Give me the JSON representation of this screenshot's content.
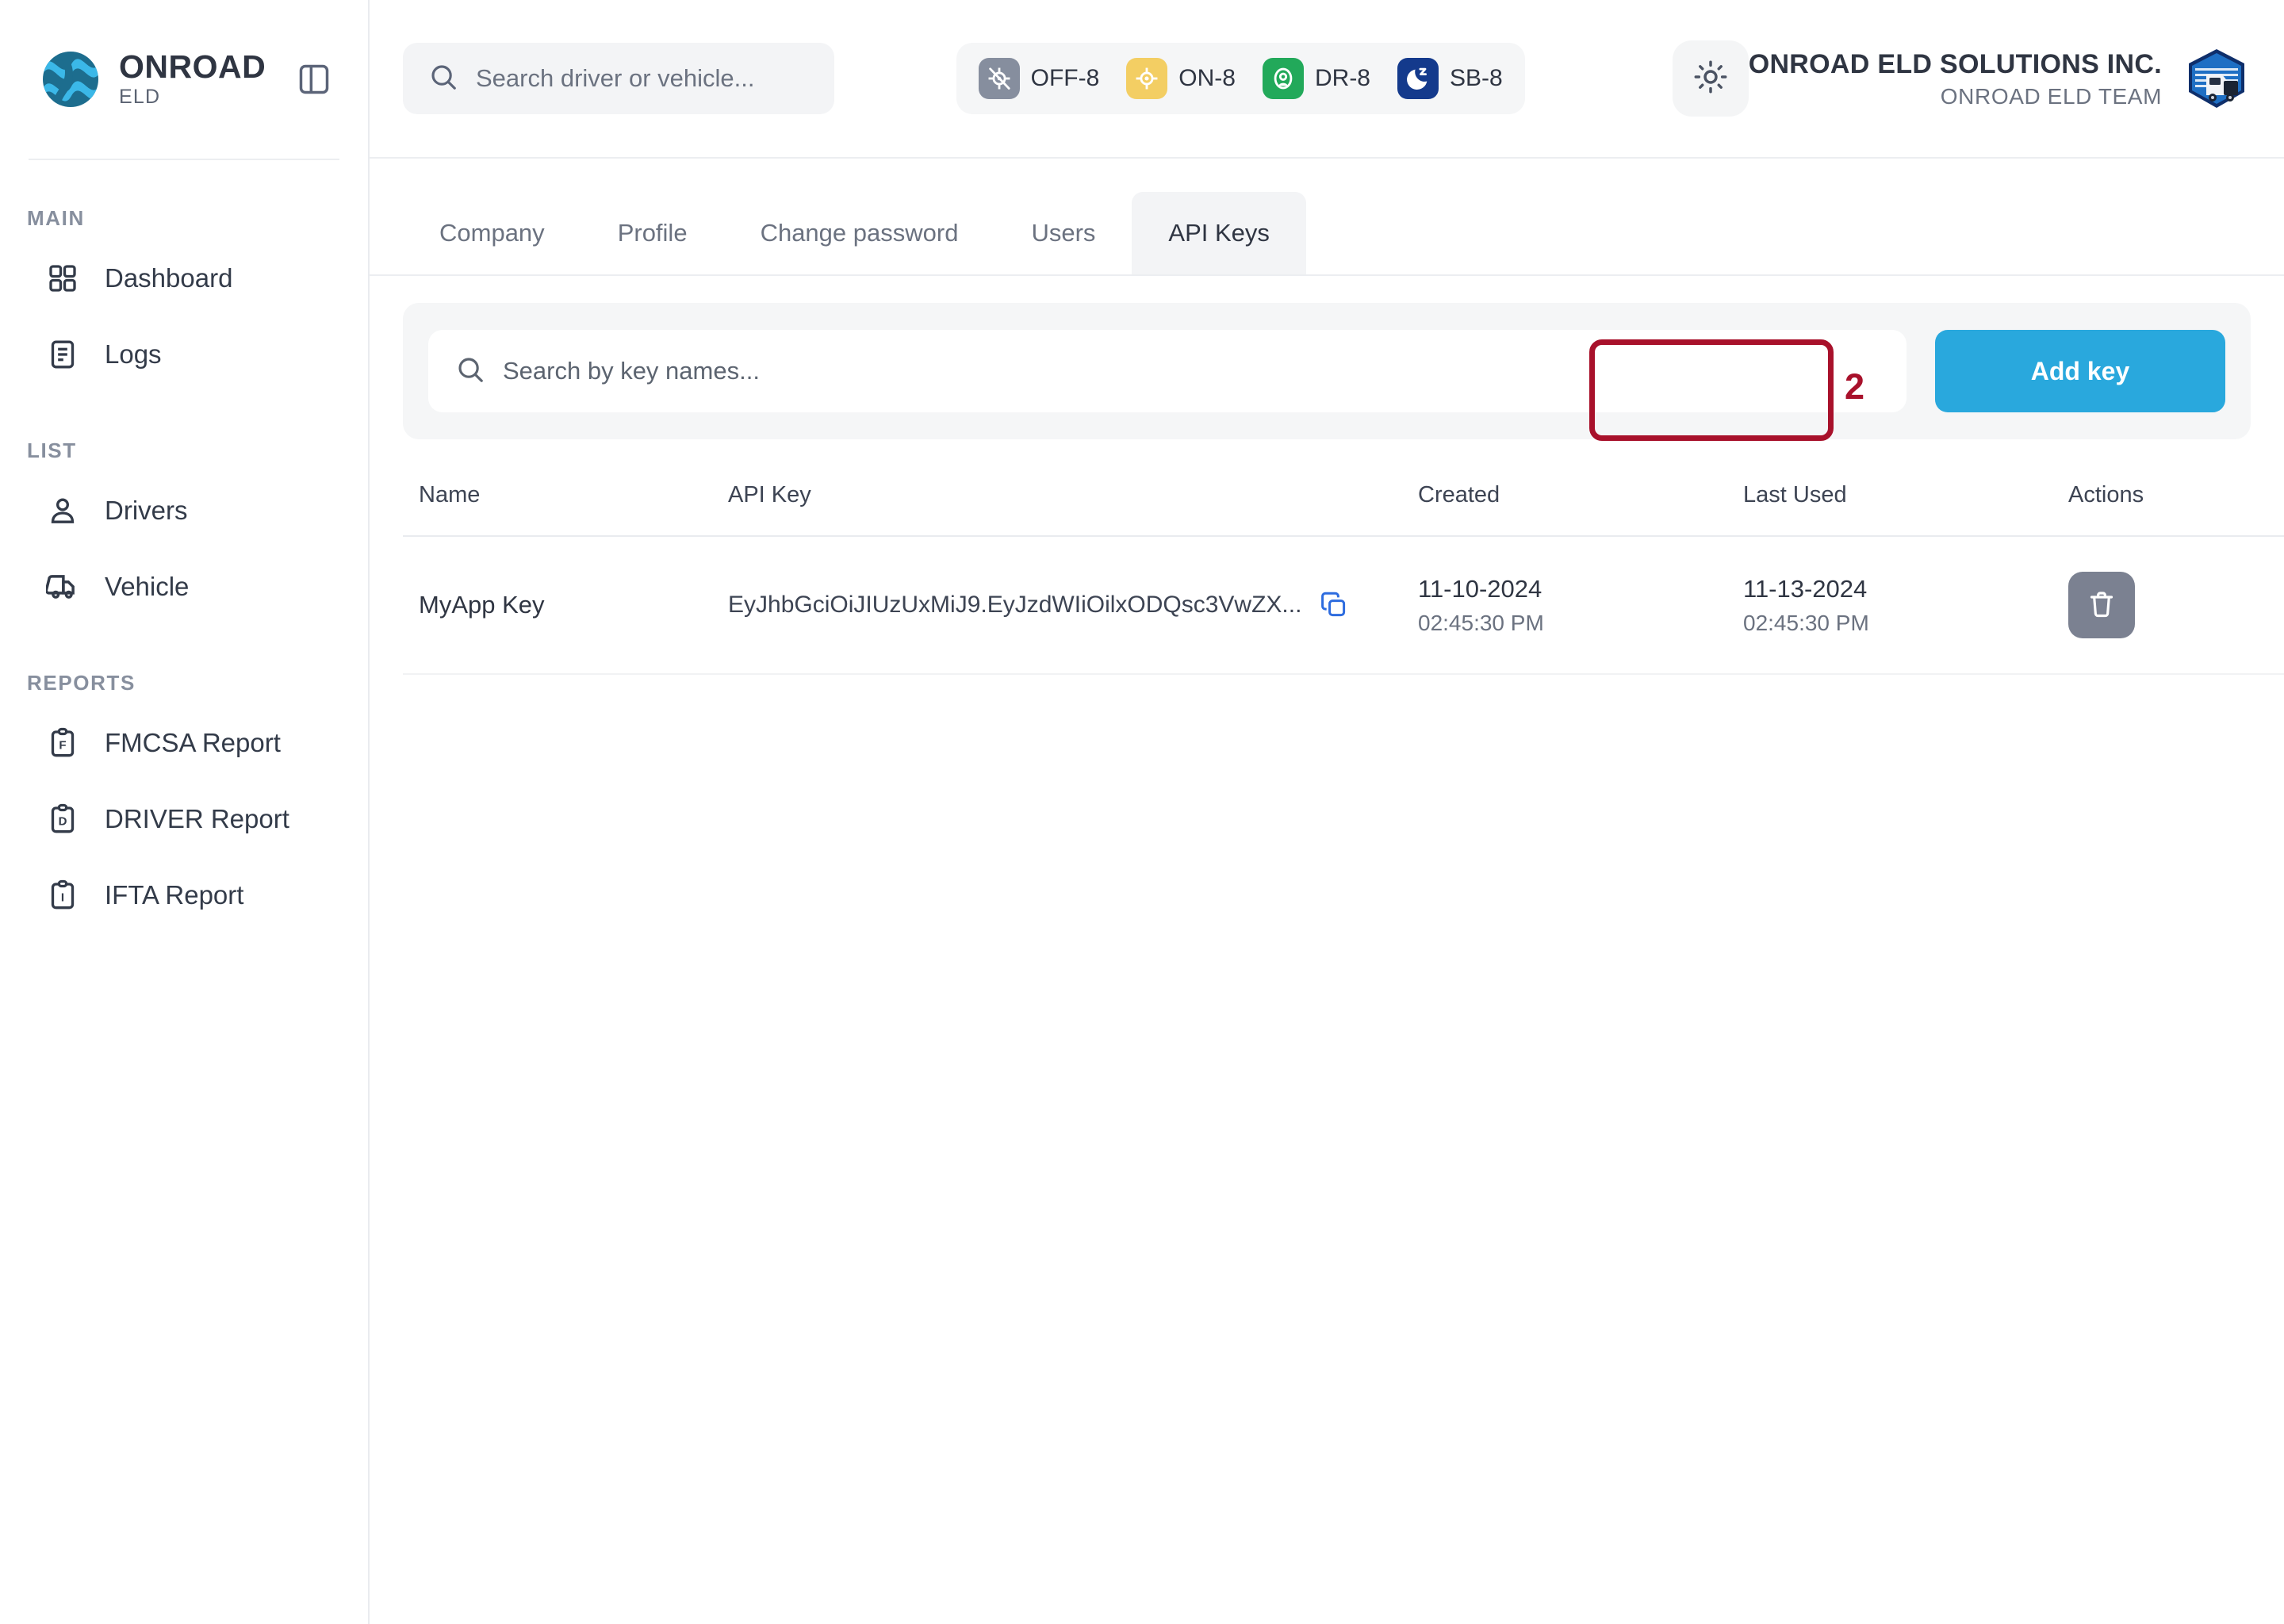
{
  "brand": {
    "title": "ONROAD",
    "subtitle": "ELD",
    "logo_icon": "onroad-globe-logo",
    "toggle_icon": "sidebar-toggle-icon"
  },
  "sidebar": {
    "sections": [
      {
        "heading": "MAIN",
        "items": [
          {
            "label": "Dashboard",
            "icon": "grid-icon"
          },
          {
            "label": "Logs",
            "icon": "document-lines-icon"
          }
        ]
      },
      {
        "heading": "LIST",
        "items": [
          {
            "label": "Drivers",
            "icon": "user-icon"
          },
          {
            "label": "Vehicle",
            "icon": "truck-icon"
          }
        ]
      },
      {
        "heading": "REPORTS",
        "items": [
          {
            "label": "FMCSA Report",
            "icon": "clipboard-f-icon"
          },
          {
            "label": "DRIVER Report",
            "icon": "clipboard-d-icon"
          },
          {
            "label": "IFTA Report",
            "icon": "clipboard-i-icon"
          }
        ]
      }
    ]
  },
  "topbar": {
    "search": {
      "placeholder": "Search driver or vehicle...",
      "value": "",
      "icon": "search-icon"
    },
    "status_chips": [
      {
        "label": "OFF-8",
        "icon": "off-duty-icon",
        "color": "#868e9e"
      },
      {
        "label": "ON-8",
        "icon": "on-duty-icon",
        "color": "#f3ce63"
      },
      {
        "label": "DR-8",
        "icon": "driving-icon",
        "color": "#22a95a"
      },
      {
        "label": "SB-8",
        "icon": "sleeper-berth-icon",
        "color": "#143a8c"
      }
    ],
    "theme_toggle": {
      "icon": "sun-icon"
    },
    "company_name": "ONROAD ELD SOLUTIONS INC.",
    "company_team": "ONROAD ELD TEAM",
    "company_logo_icon": "truck-shield-logo"
  },
  "tabs": {
    "items": [
      {
        "label": "Company",
        "active": false
      },
      {
        "label": "Profile",
        "active": false
      },
      {
        "label": "Change password",
        "active": false
      },
      {
        "label": "Users",
        "active": false
      },
      {
        "label": "API Keys",
        "active": true
      }
    ],
    "annotation_number": "2",
    "annotation_color": "#a8112b"
  },
  "toolbar": {
    "search": {
      "placeholder": "Search by key names...",
      "value": "",
      "icon": "search-icon"
    },
    "add_key_label": "Add key",
    "add_key_color": "#29a8dd"
  },
  "table": {
    "columns": [
      "Name",
      "API Key",
      "Created",
      "Last Used",
      "Actions"
    ],
    "rows": [
      {
        "name": "MyApp Key",
        "api_key": "EyJhbGciOiJIUzUxMiJ9.EyJzdWIiOilxODQsc3VwZX...",
        "copy_icon": "copy-icon",
        "created_date": "11-10-2024",
        "created_time": "02:45:30 PM",
        "last_used_date": "11-13-2024",
        "last_used_time": "02:45:30 PM",
        "delete_icon": "trash-icon"
      }
    ]
  }
}
